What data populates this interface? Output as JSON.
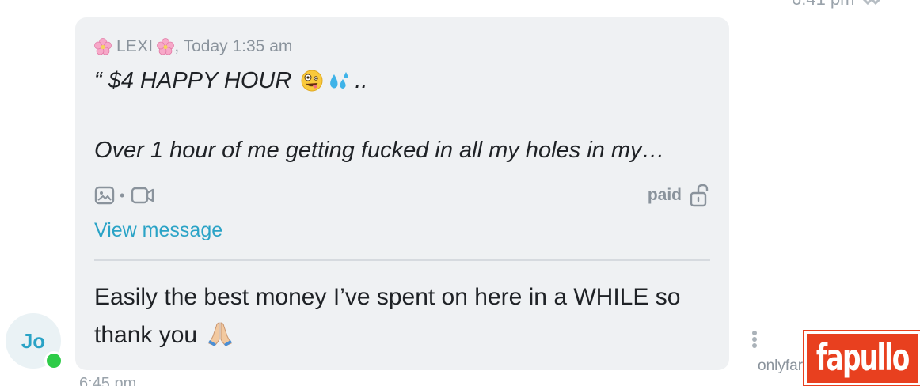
{
  "header": {
    "top_time_partial": "6:41 pm"
  },
  "quoted_message": {
    "sender_name": "LEXI",
    "timestamp": ", Today 1:35 am",
    "line1": "“ $4 HAPPY HOUR",
    "line1_suffix": "..",
    "line2": "Over 1 hour of me getting fucked in all my holes in my…",
    "price_label": "paid",
    "view_link": "View message"
  },
  "reply": {
    "text": "Easily the best money I’ve spent on here in a WHILE so thank you"
  },
  "sender": {
    "initials": "Jo",
    "online": true
  },
  "footer": {
    "bottom_time_partial": "6:45 pm",
    "site_partial": "onlyfar"
  },
  "watermark": {
    "text": "fapullo"
  },
  "colors": {
    "accent": "#2aa3c6",
    "bubble_bg": "#eff1f3",
    "muted": "#8a939c",
    "online": "#2ecc48",
    "watermark_bg": "#e8401f"
  },
  "icons": {
    "flower": "cherry-blossom-emoji",
    "face": "zany-face-emoji",
    "drops": "sweat-droplets-emoji",
    "image": "image-icon",
    "video": "video-icon",
    "lock": "unlocked-padlock-icon",
    "pray": "folded-hands-emoji",
    "menu": "kebab-menu-icon",
    "read": "double-check-icon"
  }
}
